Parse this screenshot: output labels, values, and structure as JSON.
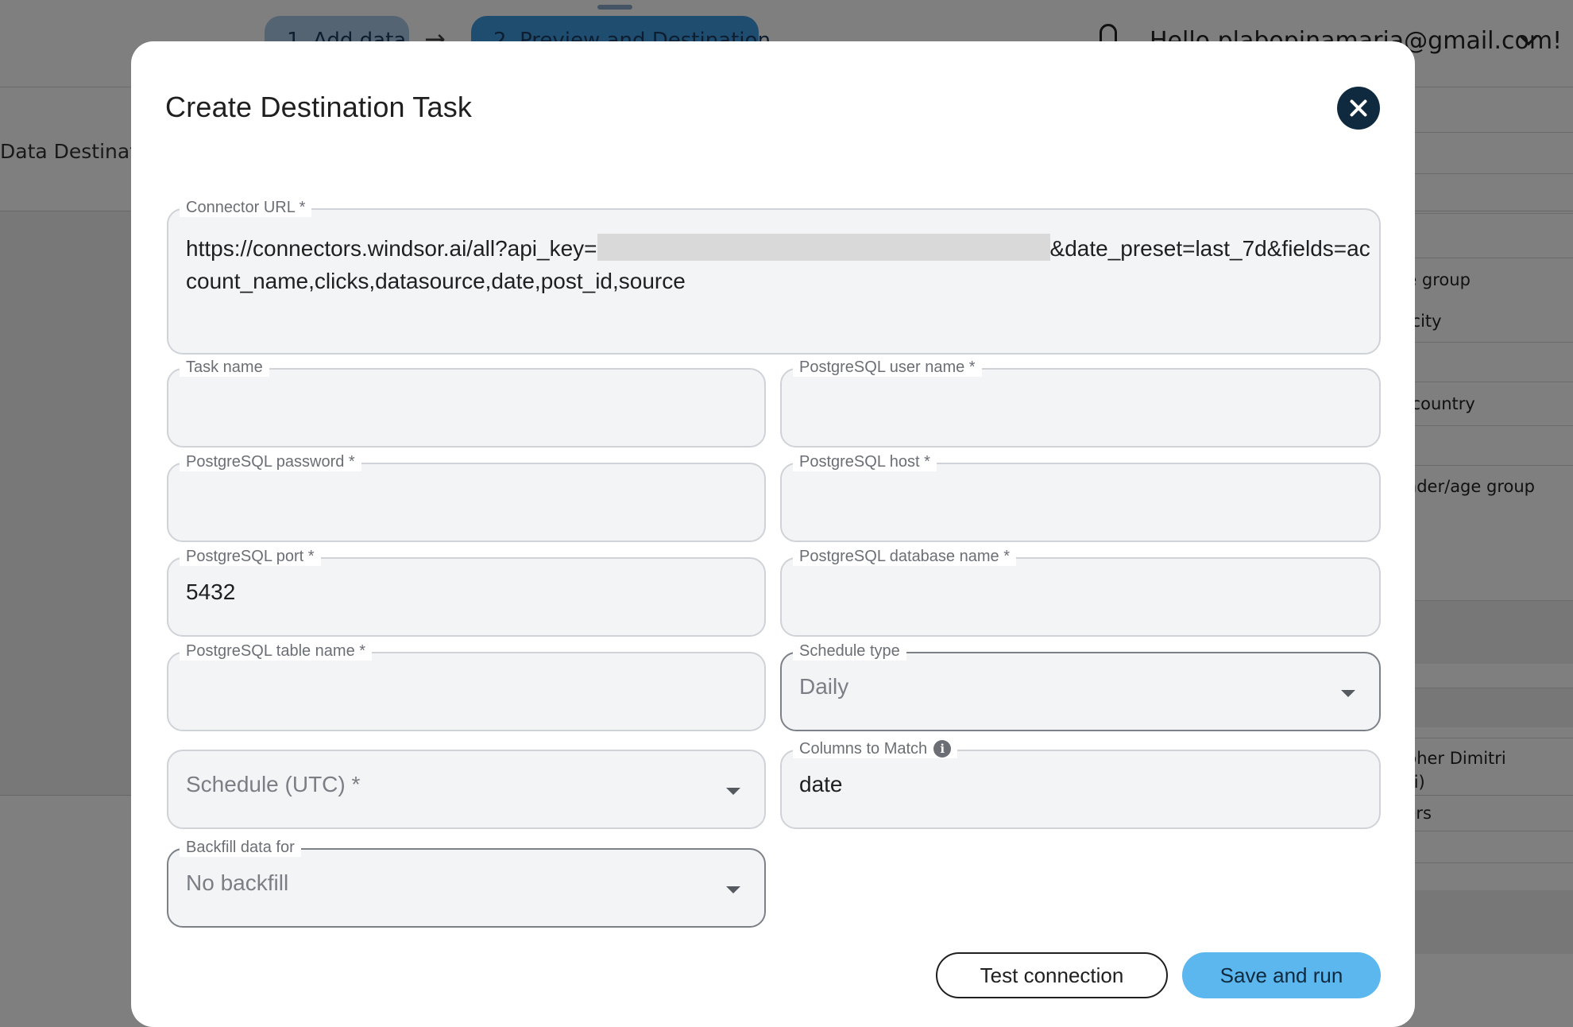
{
  "background": {
    "steps": [
      "1. Add data",
      "2. Preview and Destination"
    ],
    "step_arrow": "→",
    "greeting": "Hello plabopinamaria@gmail.com!",
    "section_title": "Data Destinati",
    "right_column_fragments": [
      "ge group",
      "a city",
      "a country",
      "ender/age group",
      "apher Dimitri",
      "itri)",
      "yers"
    ]
  },
  "modal": {
    "title": "Create Destination Task",
    "fields": {
      "connector_url": {
        "label": "Connector URL *",
        "value_prefix": "https://connectors.windsor.ai/all?api_key=",
        "value_suffix": "&date_preset=last_7d&fields=account_name,clicks,datasource,date,post_id,source"
      },
      "task_name": {
        "label": "Task name",
        "value": ""
      },
      "pg_user": {
        "label": "PostgreSQL user name *",
        "value": ""
      },
      "pg_password": {
        "label": "PostgreSQL password *",
        "value": ""
      },
      "pg_host": {
        "label": "PostgreSQL host *",
        "value": ""
      },
      "pg_port": {
        "label": "PostgreSQL port *",
        "value": "5432"
      },
      "pg_database": {
        "label": "PostgreSQL database name *",
        "value": ""
      },
      "pg_table": {
        "label": "PostgreSQL table name *",
        "value": ""
      },
      "schedule_type": {
        "label": "Schedule type",
        "value": "Daily"
      },
      "schedule_utc": {
        "placeholder": "Schedule (UTC) *"
      },
      "columns_to_match": {
        "label": "Columns to Match",
        "value": "date"
      },
      "backfill": {
        "label": "Backfill data for",
        "value": "No backfill"
      }
    },
    "buttons": {
      "test_connection": "Test connection",
      "save_and_run": "Save and run"
    }
  },
  "icons": {
    "close": "close-icon",
    "info": "info-icon",
    "caret": "chevron-down-icon",
    "bell": "bell-icon"
  },
  "colors": {
    "primary_button": "#5cb7ee",
    "close_button": "#0f2a3f",
    "field_background": "#f3f4f6"
  }
}
